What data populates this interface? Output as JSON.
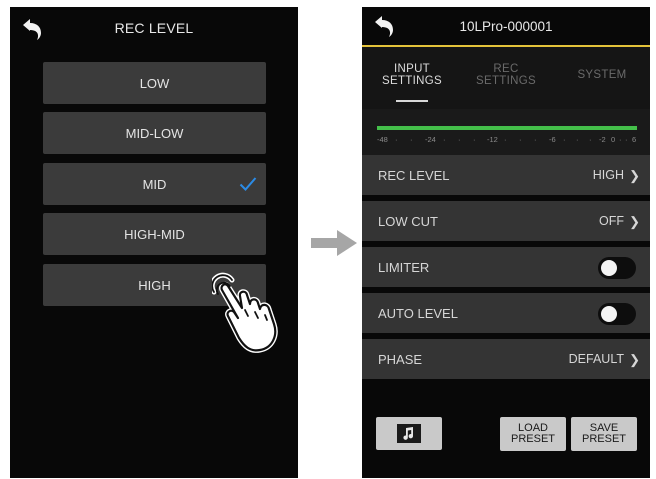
{
  "left_screen": {
    "title": "REC LEVEL",
    "options": [
      "LOW",
      "MID-LOW",
      "MID",
      "HIGH-MID",
      "HIGH"
    ],
    "selected": "MID",
    "check_color": "#2b8be6"
  },
  "right_screen": {
    "title": "10LPro-000001",
    "accent_color": "#e3c23a",
    "tabs": [
      {
        "line1": "INPUT",
        "line2": "SETTINGS",
        "active": true
      },
      {
        "line1": "REC",
        "line2": "SETTINGS",
        "active": false
      },
      {
        "line1": "SYSTEM",
        "line2": "",
        "active": false
      }
    ],
    "meter": {
      "scale": [
        "-48",
        "-24",
        "-12",
        "-6",
        "-2",
        "0",
        "6"
      ],
      "bar_color": "#44c04a"
    },
    "rows": [
      {
        "label": "REC LEVEL",
        "value": "HIGH"
      },
      {
        "label": "LOW CUT",
        "value": "OFF"
      },
      {
        "label": "LIMITER",
        "toggle": "off"
      },
      {
        "label": "AUTO LEVEL",
        "toggle": "off"
      },
      {
        "label": "PHASE",
        "value": "DEFAULT"
      }
    ],
    "buttons": {
      "music_icon": "music-note-icon",
      "load": {
        "line1": "LOAD",
        "line2": "PRESET"
      },
      "save": {
        "line1": "SAVE",
        "line2": "PRESET"
      }
    }
  }
}
